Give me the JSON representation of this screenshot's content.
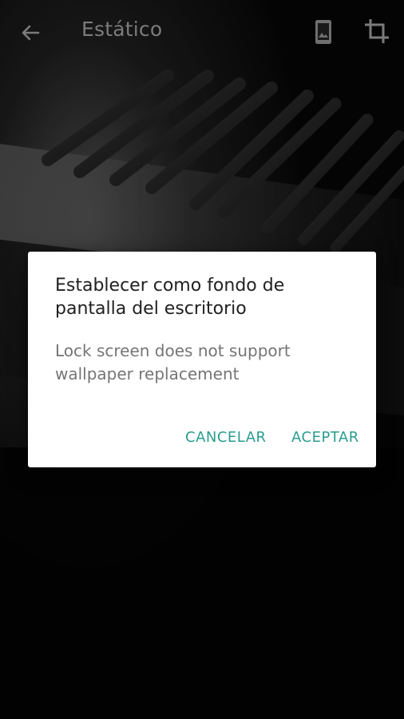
{
  "app_bar": {
    "title": "Estático",
    "back_icon": "arrow-left-icon",
    "preview_icon": "phone-wallpaper-icon",
    "crop_icon": "crop-icon",
    "title_color": "#7b7b7b"
  },
  "wallpaper": {
    "description_icon": "piano-keys-wallpaper"
  },
  "dialog": {
    "title": "Establecer como fondo de pantalla del escritorio",
    "message": "Lock screen does not support wallpaper replacement",
    "cancel_label": "CANCELAR",
    "accept_label": "ACEPTAR",
    "accent_color": "#2a9d8f"
  }
}
